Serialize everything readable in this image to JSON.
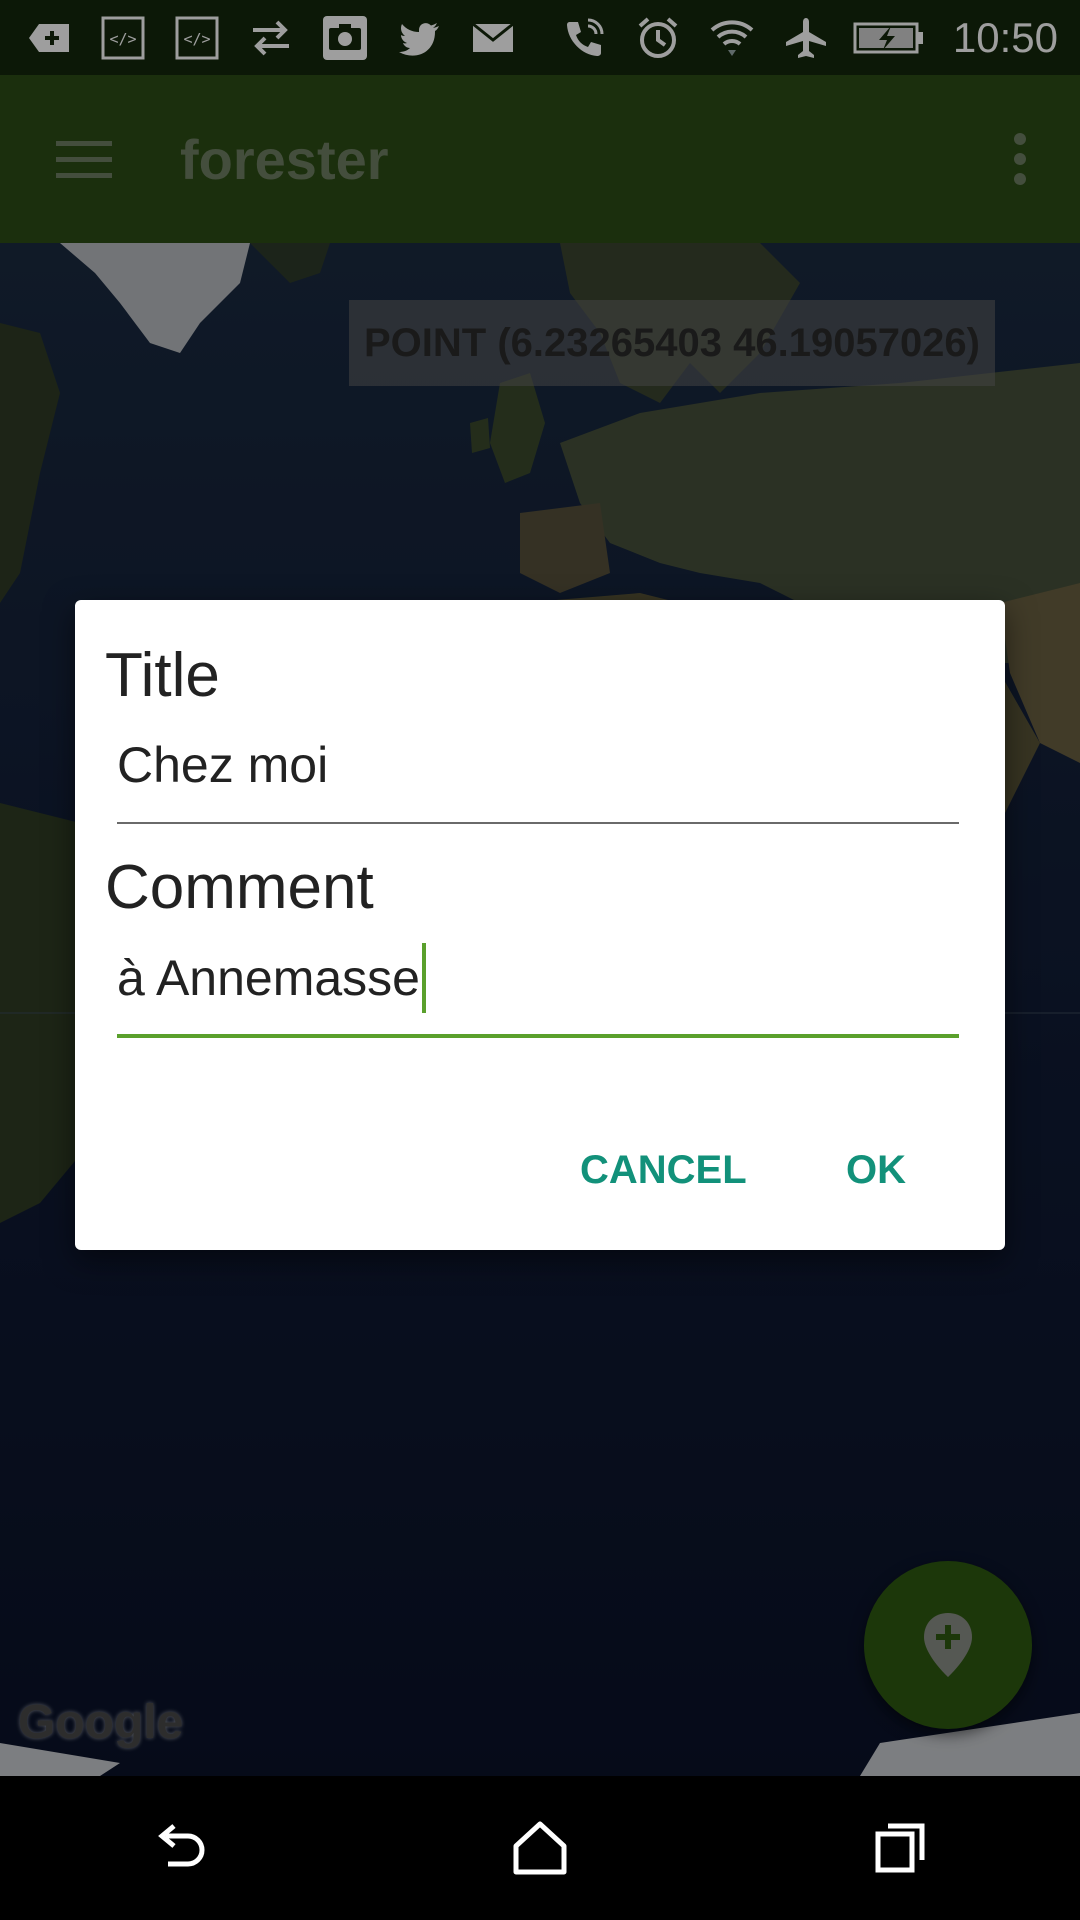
{
  "status_bar": {
    "time": "10:50",
    "icons": [
      "add-icon",
      "code-icon",
      "code-icon",
      "sync-arrows-icon",
      "camera-icon",
      "twitter-icon",
      "mail-icon",
      "phone-call-icon",
      "alarm-icon",
      "wifi-icon",
      "airplane-mode-icon",
      "battery-charging-icon"
    ]
  },
  "app_bar": {
    "title": "forester",
    "icons": [
      "menu-icon",
      "more-vert-icon"
    ]
  },
  "map": {
    "coordinate_label": "POINT (6.23265403 46.19057026)",
    "attribution": "Google",
    "fab_icon": "add-location-icon"
  },
  "dialog": {
    "title_label": "Title",
    "title_value": "Chez moi",
    "comment_label": "Comment",
    "comment_value": "à Annemasse",
    "cancel_label": "CANCEL",
    "ok_label": "OK"
  },
  "colors": {
    "status_bar_bg": "#14280c",
    "app_bar_bg": "#2d4d15",
    "fab_bg": "#2e5a11",
    "accent": "#12917a",
    "focus_line": "#5aa02c"
  },
  "nav_bar": {
    "icons": [
      "back-icon",
      "home-icon",
      "recents-icon"
    ]
  }
}
